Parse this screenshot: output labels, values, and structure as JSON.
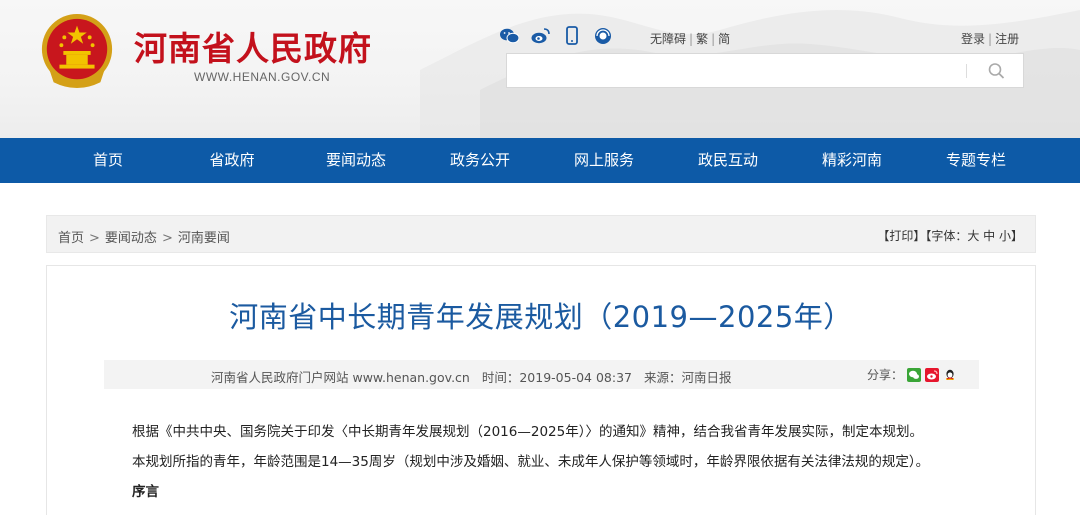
{
  "site": {
    "title": "河南省人民政府",
    "url": "WWW.HENAN.GOV.CN"
  },
  "social_icons": [
    "wechat-icon",
    "weibo-icon",
    "mobile-icon",
    "app-icon"
  ],
  "accessibility": {
    "barrier_free": "无障碍",
    "traditional": "繁",
    "simplified": "简"
  },
  "account": {
    "login": "登录",
    "register": "注册"
  },
  "search": {
    "placeholder": ""
  },
  "nav": [
    "首页",
    "省政府",
    "要闻动态",
    "政务公开",
    "网上服务",
    "政民互动",
    "精彩河南",
    "专题专栏"
  ],
  "breadcrumb": {
    "items": [
      "首页",
      "要闻动态",
      "河南要闻"
    ],
    "tools": "【打印】【字体：大 中 小】"
  },
  "article": {
    "title": "河南省中长期青年发展规划（2019—2025年）",
    "meta": {
      "source_site": "河南省人民政府门户网站 www.henan.gov.cn",
      "time": "时间：2019-05-04 08:37",
      "origin": "来源：河南日报"
    },
    "share_label": "分享：",
    "paragraphs": [
      "根据《中共中央、国务院关于印发〈中长期青年发展规划（2016—2025年）〉的通知》精神，结合我省青年发展实际，制定本规划。",
      "本规划所指的青年，年龄范围是14—35周岁（规划中涉及婚姻、就业、未成年人保护等领域时，年龄界限依据有关法律法规的规定）。"
    ],
    "section_heading": "序言"
  },
  "colors": {
    "brand_red": "#c3111c",
    "nav_blue": "#0d5aa7",
    "title_blue": "#1b5aa0"
  }
}
